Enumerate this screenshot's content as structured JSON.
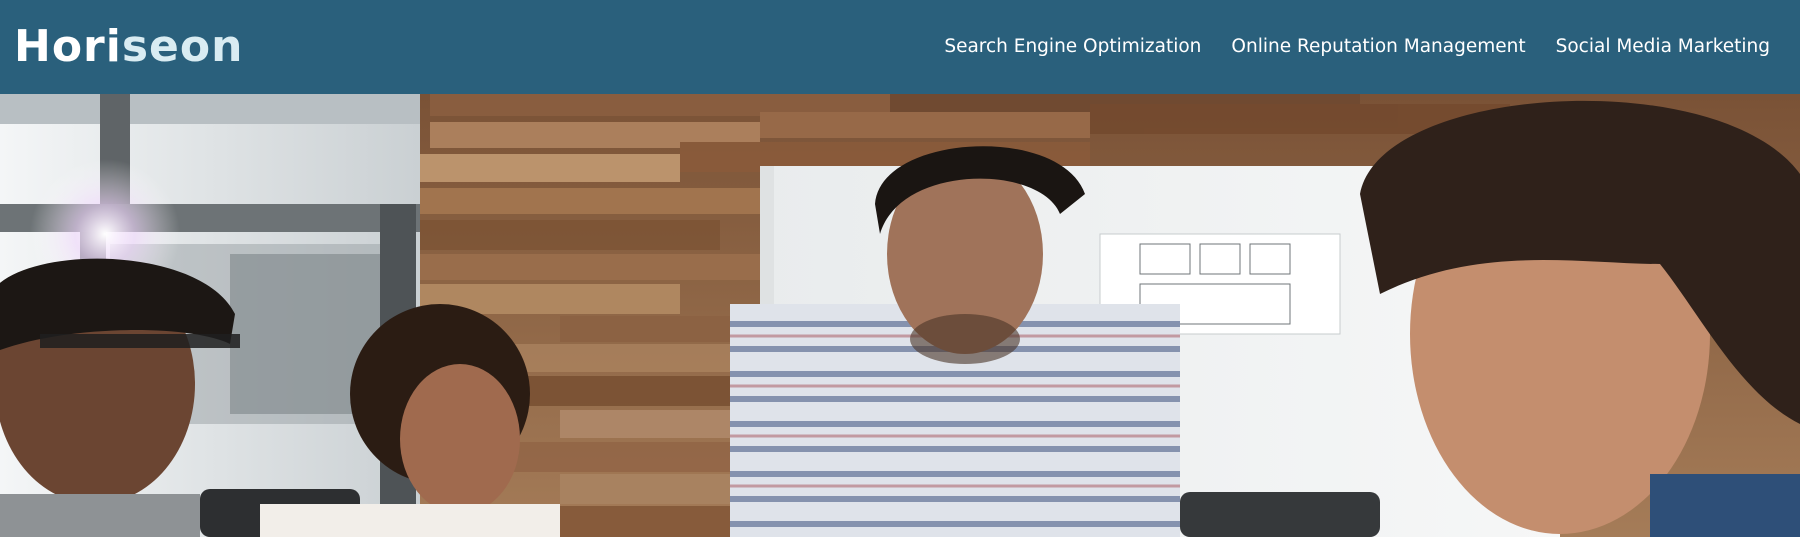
{
  "header": {
    "logo_prefix": "Hori",
    "logo_suffix": "seon",
    "brand_color": "#2a607c",
    "nav": [
      {
        "label": "Search Engine Optimization"
      },
      {
        "label": "Online Reputation Management"
      },
      {
        "label": "Social Media Marketing"
      }
    ]
  },
  "hero": {
    "image_icon": "team-meeting-photo"
  }
}
